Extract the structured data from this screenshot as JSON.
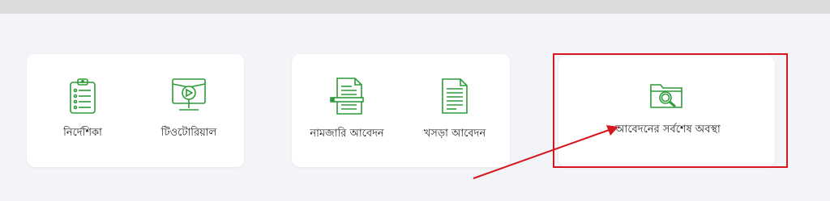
{
  "theme": {
    "icon_color": "#2e9b3a",
    "highlight_color": "#d6181e"
  },
  "cards": [
    {
      "items": [
        {
          "label": "নির্দেশিকা",
          "icon": "clipboard-list-icon"
        },
        {
          "label": "টিওটোরিয়াল",
          "icon": "video-tutorial-icon"
        }
      ]
    },
    {
      "items": [
        {
          "label": "নামজারি আবেদন",
          "icon": "document-edit-icon"
        },
        {
          "label": "খসড়া আবেদন",
          "icon": "draft-document-icon"
        }
      ]
    },
    {
      "items": [
        {
          "label": "আবেদনের সর্বশেষ অবস্থা",
          "icon": "folder-search-icon"
        }
      ]
    }
  ]
}
